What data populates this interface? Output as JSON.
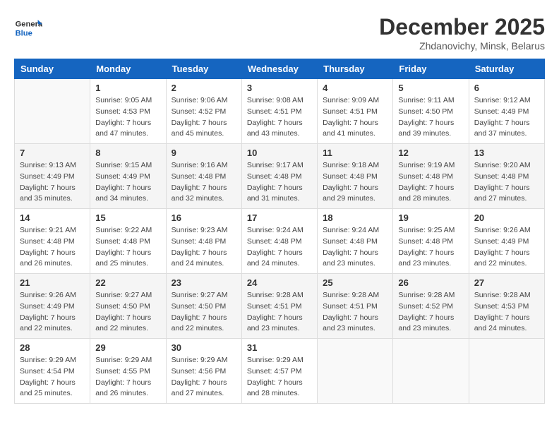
{
  "header": {
    "logo_general": "General",
    "logo_blue": "Blue",
    "month_title": "December 2025",
    "subtitle": "Zhdanovichy, Minsk, Belarus"
  },
  "days_of_week": [
    "Sunday",
    "Monday",
    "Tuesday",
    "Wednesday",
    "Thursday",
    "Friday",
    "Saturday"
  ],
  "weeks": [
    [
      {
        "day": "",
        "info": ""
      },
      {
        "day": "1",
        "info": "Sunrise: 9:05 AM\nSunset: 4:53 PM\nDaylight: 7 hours\nand 47 minutes."
      },
      {
        "day": "2",
        "info": "Sunrise: 9:06 AM\nSunset: 4:52 PM\nDaylight: 7 hours\nand 45 minutes."
      },
      {
        "day": "3",
        "info": "Sunrise: 9:08 AM\nSunset: 4:51 PM\nDaylight: 7 hours\nand 43 minutes."
      },
      {
        "day": "4",
        "info": "Sunrise: 9:09 AM\nSunset: 4:51 PM\nDaylight: 7 hours\nand 41 minutes."
      },
      {
        "day": "5",
        "info": "Sunrise: 9:11 AM\nSunset: 4:50 PM\nDaylight: 7 hours\nand 39 minutes."
      },
      {
        "day": "6",
        "info": "Sunrise: 9:12 AM\nSunset: 4:49 PM\nDaylight: 7 hours\nand 37 minutes."
      }
    ],
    [
      {
        "day": "7",
        "info": "Sunrise: 9:13 AM\nSunset: 4:49 PM\nDaylight: 7 hours\nand 35 minutes."
      },
      {
        "day": "8",
        "info": "Sunrise: 9:15 AM\nSunset: 4:49 PM\nDaylight: 7 hours\nand 34 minutes."
      },
      {
        "day": "9",
        "info": "Sunrise: 9:16 AM\nSunset: 4:48 PM\nDaylight: 7 hours\nand 32 minutes."
      },
      {
        "day": "10",
        "info": "Sunrise: 9:17 AM\nSunset: 4:48 PM\nDaylight: 7 hours\nand 31 minutes."
      },
      {
        "day": "11",
        "info": "Sunrise: 9:18 AM\nSunset: 4:48 PM\nDaylight: 7 hours\nand 29 minutes."
      },
      {
        "day": "12",
        "info": "Sunrise: 9:19 AM\nSunset: 4:48 PM\nDaylight: 7 hours\nand 28 minutes."
      },
      {
        "day": "13",
        "info": "Sunrise: 9:20 AM\nSunset: 4:48 PM\nDaylight: 7 hours\nand 27 minutes."
      }
    ],
    [
      {
        "day": "14",
        "info": "Sunrise: 9:21 AM\nSunset: 4:48 PM\nDaylight: 7 hours\nand 26 minutes."
      },
      {
        "day": "15",
        "info": "Sunrise: 9:22 AM\nSunset: 4:48 PM\nDaylight: 7 hours\nand 25 minutes."
      },
      {
        "day": "16",
        "info": "Sunrise: 9:23 AM\nSunset: 4:48 PM\nDaylight: 7 hours\nand 24 minutes."
      },
      {
        "day": "17",
        "info": "Sunrise: 9:24 AM\nSunset: 4:48 PM\nDaylight: 7 hours\nand 24 minutes."
      },
      {
        "day": "18",
        "info": "Sunrise: 9:24 AM\nSunset: 4:48 PM\nDaylight: 7 hours\nand 23 minutes."
      },
      {
        "day": "19",
        "info": "Sunrise: 9:25 AM\nSunset: 4:48 PM\nDaylight: 7 hours\nand 23 minutes."
      },
      {
        "day": "20",
        "info": "Sunrise: 9:26 AM\nSunset: 4:49 PM\nDaylight: 7 hours\nand 22 minutes."
      }
    ],
    [
      {
        "day": "21",
        "info": "Sunrise: 9:26 AM\nSunset: 4:49 PM\nDaylight: 7 hours\nand 22 minutes."
      },
      {
        "day": "22",
        "info": "Sunrise: 9:27 AM\nSunset: 4:50 PM\nDaylight: 7 hours\nand 22 minutes."
      },
      {
        "day": "23",
        "info": "Sunrise: 9:27 AM\nSunset: 4:50 PM\nDaylight: 7 hours\nand 22 minutes."
      },
      {
        "day": "24",
        "info": "Sunrise: 9:28 AM\nSunset: 4:51 PM\nDaylight: 7 hours\nand 23 minutes."
      },
      {
        "day": "25",
        "info": "Sunrise: 9:28 AM\nSunset: 4:51 PM\nDaylight: 7 hours\nand 23 minutes."
      },
      {
        "day": "26",
        "info": "Sunrise: 9:28 AM\nSunset: 4:52 PM\nDaylight: 7 hours\nand 23 minutes."
      },
      {
        "day": "27",
        "info": "Sunrise: 9:28 AM\nSunset: 4:53 PM\nDaylight: 7 hours\nand 24 minutes."
      }
    ],
    [
      {
        "day": "28",
        "info": "Sunrise: 9:29 AM\nSunset: 4:54 PM\nDaylight: 7 hours\nand 25 minutes."
      },
      {
        "day": "29",
        "info": "Sunrise: 9:29 AM\nSunset: 4:55 PM\nDaylight: 7 hours\nand 26 minutes."
      },
      {
        "day": "30",
        "info": "Sunrise: 9:29 AM\nSunset: 4:56 PM\nDaylight: 7 hours\nand 27 minutes."
      },
      {
        "day": "31",
        "info": "Sunrise: 9:29 AM\nSunset: 4:57 PM\nDaylight: 7 hours\nand 28 minutes."
      },
      {
        "day": "",
        "info": ""
      },
      {
        "day": "",
        "info": ""
      },
      {
        "day": "",
        "info": ""
      }
    ]
  ]
}
